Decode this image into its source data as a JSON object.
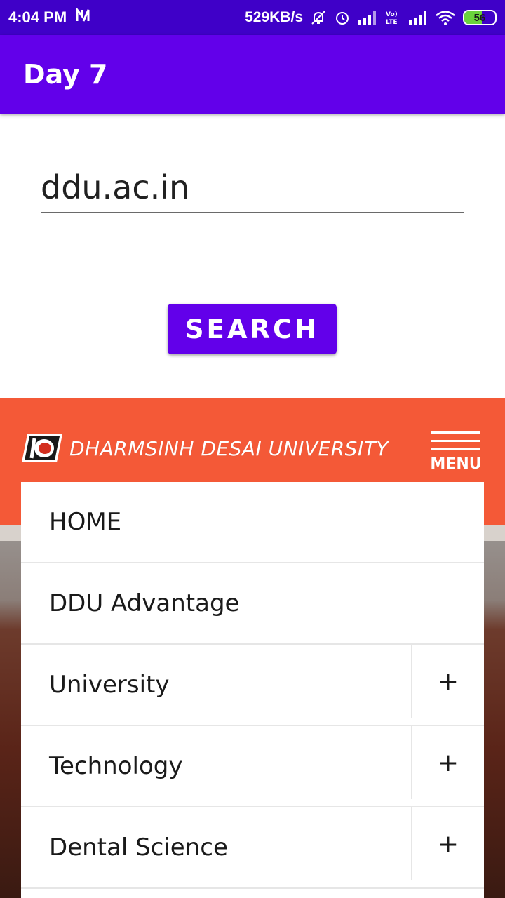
{
  "status_bar": {
    "time": "4:04 PM",
    "speed": "529KB/s",
    "battery": "56"
  },
  "app_bar": {
    "title": "Day 7"
  },
  "url_input": {
    "value": "ddu.ac.in"
  },
  "search_button": {
    "label": "SEARCH"
  },
  "webview": {
    "site_name": "DHARMSINH DESAI UNIVERSITY",
    "menu_label": "MENU",
    "nav_items": [
      {
        "label": "HOME",
        "expandable": false
      },
      {
        "label": "DDU Advantage",
        "expandable": false
      },
      {
        "label": "University",
        "expandable": true
      },
      {
        "label": "Technology",
        "expandable": true
      },
      {
        "label": "Dental Science",
        "expandable": true
      }
    ],
    "expand_symbol": "+"
  },
  "colors": {
    "status_bar": "#3f00c8",
    "app_bar": "#6200ea",
    "site_header": "#f45937"
  }
}
